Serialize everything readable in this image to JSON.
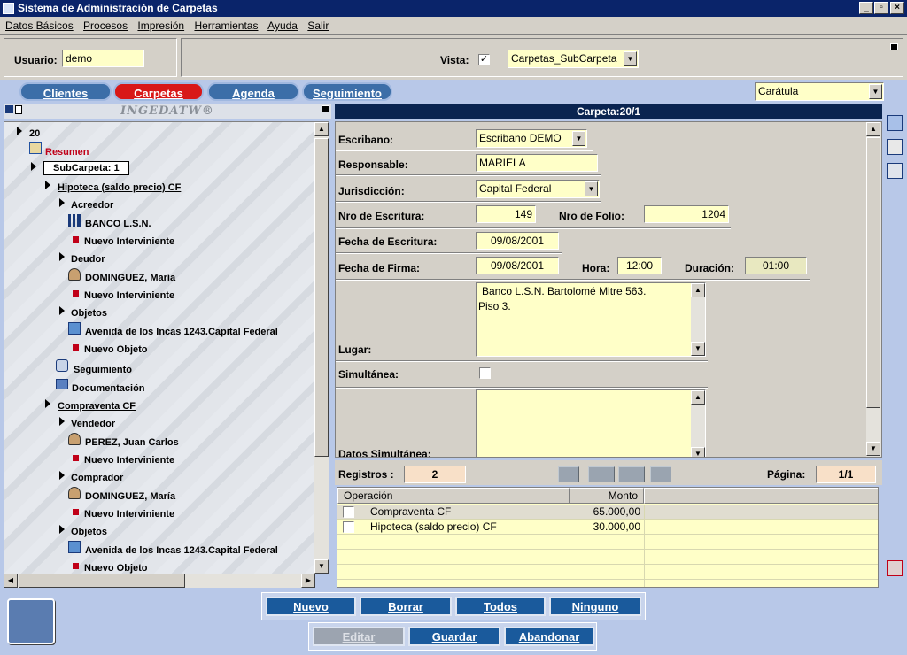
{
  "window": {
    "title": "Sistema de Administración de Carpetas"
  },
  "menu": [
    "Datos Básicos",
    "Procesos",
    "Impresión",
    "Herramientas",
    "Ayuda",
    "Salir"
  ],
  "header": {
    "usuario_label": "Usuario:",
    "usuario_value": "demo",
    "vista_label": "Vista:",
    "vista_checked": "✓",
    "vista_value": "Carpetas_SubCarpeta"
  },
  "tabs": [
    "Clientes",
    "Carpetas",
    "Agenda",
    "Seguimiento"
  ],
  "caratula": "Carátula",
  "logo": "INGEDATW®",
  "carpeta_title": "Carpeta:20/1",
  "tree": {
    "root": "20",
    "resumen": "Resumen",
    "subcarpeta": "SubCarpeta: 1",
    "hipoteca": "Hipoteca (saldo precio) CF",
    "acreedor": "Acreedor",
    "banco": "BANCO L.S.N.",
    "nuevo_int": "Nuevo Interviniente",
    "deudor": "Deudor",
    "dominguez": "DOMINGUEZ, María",
    "objetos": "Objetos",
    "avenida": "Avenida de los Incas 1243.Capital Federal",
    "nuevo_obj": "Nuevo Objeto",
    "seguimiento": "Seguimiento",
    "documentacion": "Documentación",
    "compraventa": "Compraventa CF",
    "vendedor": "Vendedor",
    "perez": "PEREZ, Juan Carlos",
    "comprador": "Comprador"
  },
  "form": {
    "escribano_label": "Escribano:",
    "escribano_value": "Escribano DEMO",
    "responsable_label": "Responsable:",
    "responsable_value": "MARIELA",
    "jurisdiccion_label": "Jurisdicción:",
    "jurisdiccion_value": "Capital Federal",
    "nro_escritura_label": "Nro de Escritura:",
    "nro_escritura_value": "149",
    "nro_folio_label": "Nro de Folio:",
    "nro_folio_value": "1204",
    "fecha_escritura_label": "Fecha de Escritura:",
    "fecha_escritura_value": "09/08/2001",
    "fecha_firma_label": "Fecha de Firma:",
    "fecha_firma_value": "09/08/2001",
    "hora_label": "Hora:",
    "hora_value": "12:00",
    "duracion_label": "Duración:",
    "duracion_value": "01:00",
    "lugar_label": "Lugar:",
    "lugar_line1": "Banco L.S.N. Bartolomé Mitre 563.",
    "lugar_line2": "Piso 3.",
    "simultanea_label": "Simultánea:",
    "datos_simultanea_label": "Datos Simultánea:"
  },
  "registros": {
    "label": "Registros :",
    "value": "2",
    "pagina_label": "Página:",
    "pagina_value": "1/1"
  },
  "grid": {
    "headers": [
      "Operación",
      "Monto"
    ],
    "rows": [
      {
        "op": "Compraventa CF",
        "monto": "65.000,00"
      },
      {
        "op": "Hipoteca (saldo precio) CF",
        "monto": "30.000,00"
      }
    ]
  },
  "actions": {
    "nuevo": "Nuevo",
    "borrar": "Borrar",
    "todos": "Todos",
    "ninguno": "Ninguno",
    "editar": "Editar",
    "guardar": "Guardar",
    "abandonar": "Abandonar"
  }
}
